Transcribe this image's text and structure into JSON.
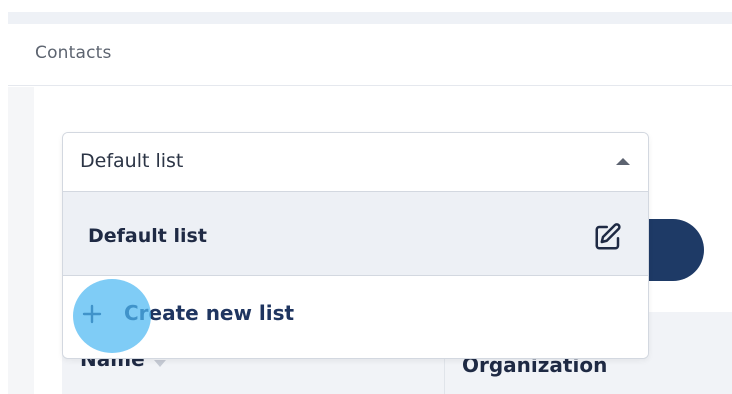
{
  "header": {
    "title": "Contacts"
  },
  "list_selector": {
    "selected_value": "Default list",
    "options": [
      {
        "label": "Default list",
        "icon": "edit-icon"
      }
    ],
    "create_label": "Create new list",
    "create_icon": "plus-icon"
  },
  "table": {
    "columns": [
      {
        "label": "Name",
        "sort_icon": "sort-down-icon"
      },
      {
        "label": "Organization"
      }
    ]
  },
  "colors": {
    "primary": "#1e3a66",
    "click_highlight": "#4db8f2",
    "option_hover_bg": "#edf0f5"
  }
}
